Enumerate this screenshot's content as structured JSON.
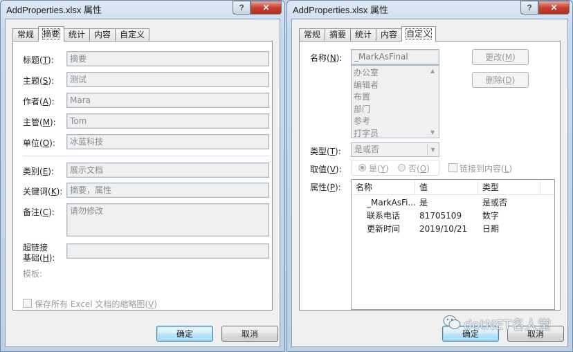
{
  "left_dialog": {
    "title": "AddProperties.xlsx 属性",
    "help_label": "?",
    "close_label": "✕",
    "tabs": [
      {
        "label": "常规",
        "active": false
      },
      {
        "label": "摘要",
        "active": true
      },
      {
        "label": "统计",
        "active": false
      },
      {
        "label": "内容",
        "active": false
      },
      {
        "label": "自定义",
        "active": false
      }
    ],
    "fields": [
      {
        "label": "标题(",
        "key": "T",
        "value": "摘要"
      },
      {
        "label": "主题(",
        "key": "S",
        "value": "测试"
      },
      {
        "label": "作者(",
        "key": "A",
        "value": "Mara"
      },
      {
        "label": "主管(",
        "key": "M",
        "value": "Tom"
      },
      {
        "label": "单位(",
        "key": "O",
        "value": "冰蓝科技"
      },
      {
        "label": "类别(",
        "key": "E",
        "value": "展示文档"
      },
      {
        "label": "关键词(",
        "key": "K",
        "value": "摘要，属性"
      },
      {
        "label": "备注(",
        "key": "C",
        "value": "请勿修改"
      }
    ],
    "label_suffix": "):",
    "hyperlink_label_line1": "超链接",
    "hyperlink_label_line2": "基础(",
    "hyperlink_key": "H",
    "hyperlink_value": "",
    "template_label": "模板:",
    "thumbnail_checkbox_label": "保存所有 Excel 文档的缩略图(",
    "thumbnail_key": "V",
    "thumbnail_checked": false,
    "ok_label": "确定",
    "cancel_label": "取消"
  },
  "right_dialog": {
    "title": "AddProperties.xlsx 属性",
    "help_label": "?",
    "close_label": "✕",
    "tabs": [
      {
        "label": "常规",
        "active": false
      },
      {
        "label": "摘要",
        "active": false
      },
      {
        "label": "统计",
        "active": false
      },
      {
        "label": "内容",
        "active": false
      },
      {
        "label": "自定义",
        "active": true
      }
    ],
    "name_label": "名称(",
    "name_key": "N",
    "name_value": "_MarkAsFinal",
    "name_options": [
      "办公室",
      "编辑者",
      "布置",
      "部门",
      "参考",
      "打字员"
    ],
    "modify_label": "更改(",
    "modify_key": "M",
    "delete_label": "删除(",
    "delete_key": "D",
    "type_label": "类型(",
    "type_key": "T",
    "type_value": "是或否",
    "value_label": "取值(",
    "value_key": "V",
    "radio_yes_label": "是(",
    "radio_yes_key": "Y",
    "radio_no_label": "否(",
    "radio_no_key": "O",
    "radio_selected": "yes",
    "link_checkbox_label": "链接到内容(",
    "link_key": "L",
    "link_checked": false,
    "properties_label": "属性(",
    "properties_key": "P",
    "label_suffix": "):",
    "close_paren": ")",
    "columns": [
      "名称",
      "值",
      "类型"
    ],
    "properties": [
      {
        "name": "_MarkAsFi...",
        "value": "是",
        "type": "是或否"
      },
      {
        "name": "联系电话",
        "value": "81705109",
        "type": "数字"
      },
      {
        "name": "更新时间",
        "value": "2019/10/21",
        "type": "日期"
      }
    ],
    "ok_label": "确定",
    "cancel_label": "取消"
  },
  "watermark": {
    "icon": "wechat-icon",
    "text": "dotNET名人堂"
  }
}
